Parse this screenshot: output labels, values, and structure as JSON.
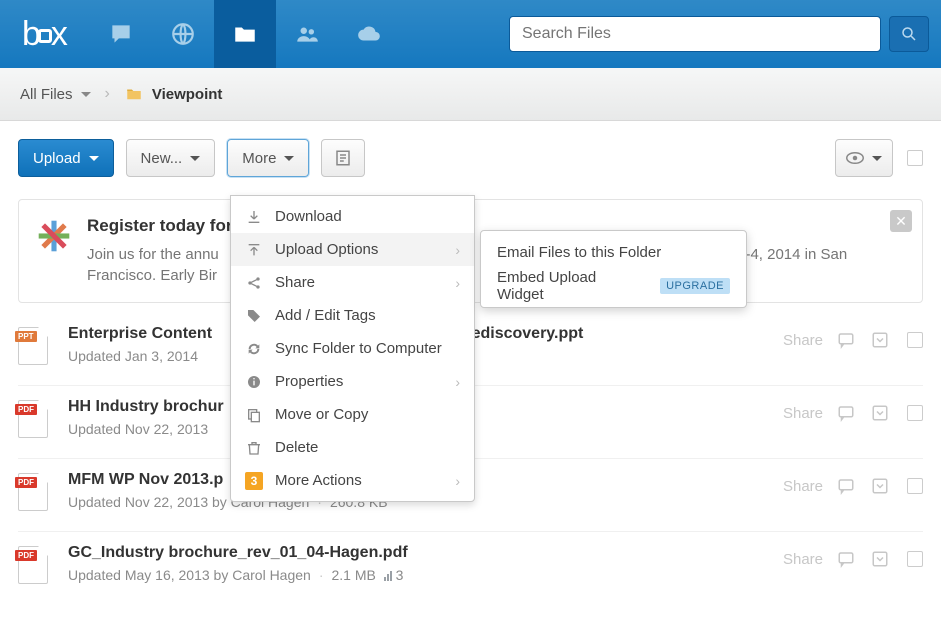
{
  "nav": {
    "search_placeholder": "Search Files"
  },
  "crumb": {
    "root": "All Files",
    "current": "Viewpoint"
  },
  "toolbar": {
    "upload": "Upload",
    "new": "New...",
    "more": "More"
  },
  "menu": {
    "download": "Download",
    "upload_options": "Upload Options",
    "share": "Share",
    "tags": "Add / Edit Tags",
    "sync": "Sync Folder to Computer",
    "properties": "Properties",
    "move": "Move or Copy",
    "delete": "Delete",
    "more_actions": "More Actions",
    "more_badge": "3"
  },
  "submenu": {
    "email": "Email Files to this Folder",
    "embed": "Embed Upload Widget",
    "upgrade": "UPGRADE"
  },
  "banner": {
    "title": "Register today for",
    "sub_a": "Join us for the annu",
    "sub_b": "Francisco. Early Bir",
    "date": "2-4, 2014 in San"
  },
  "share_label": "Share",
  "files": [
    {
      "type": "ppt",
      "name_a": "Enterprise Content",
      "name_b": "r ediscovery.ppt",
      "meta": "Updated Jan 3, 2014"
    },
    {
      "type": "pdf",
      "name": "HH Industry brochur",
      "meta": "Updated Nov 22, 2013"
    },
    {
      "type": "pdf",
      "name": "MFM WP Nov 2013.p",
      "meta": "Updated Nov 22, 2013 by Carol Hagen",
      "size": "260.8 KB"
    },
    {
      "type": "pdf",
      "name": "GC_Industry brochure_rev_01_04-Hagen.pdf",
      "meta": "Updated May 16, 2013 by Carol Hagen",
      "size": "2.1 MB",
      "count": "3"
    }
  ]
}
